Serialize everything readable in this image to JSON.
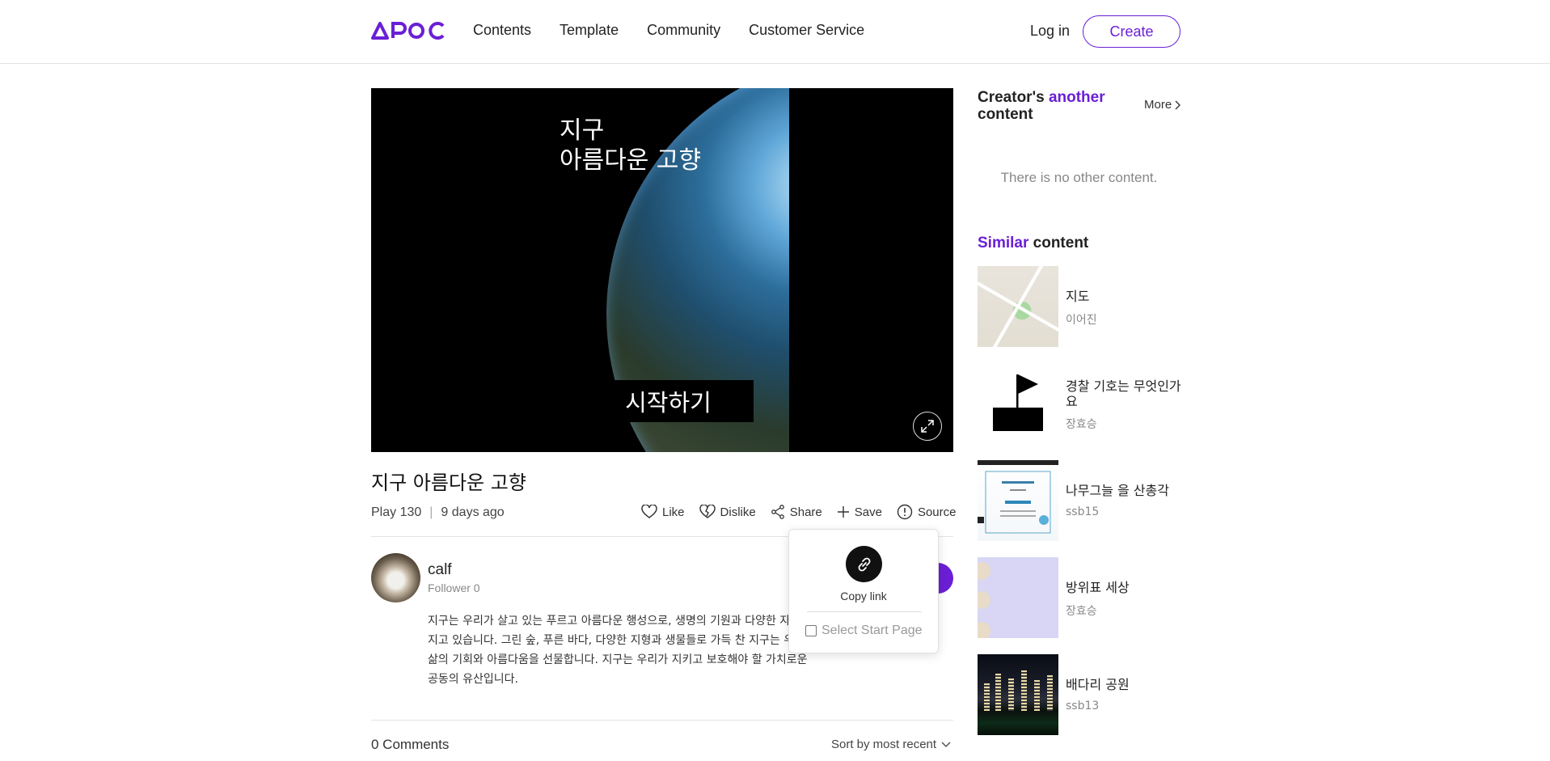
{
  "header": {
    "logo_text": "APOC",
    "nav": [
      "Contents",
      "Template",
      "Community",
      "Customer Service"
    ],
    "login_label": "Log in",
    "create_label": "Create",
    "brand_color": "#6a1fd6"
  },
  "player": {
    "slide_title_line1": "지구",
    "slide_title_line2": "아름다운 고향",
    "start_button": "시작하기",
    "fullscreen_icon": "expand-icon"
  },
  "content": {
    "title": "지구 아름다운 고향",
    "play": "Play 130",
    "separator": "|",
    "posted": "9 days ago",
    "actions": {
      "like": "Like",
      "dislike": "Dislike",
      "share": "Share",
      "save": "Save",
      "source": "Source"
    }
  },
  "creator": {
    "name": "calf",
    "followers": "Follower 0",
    "description": "지구는 우리가 살고 있는 푸르고 아름다운 행성으로, 생명의 기원과 다양한 자원을 지고 있습니다. 그린 숲, 푸른 바다, 다양한 지형과 생물들로 가득 찬 지구는 우리 삶의 기회와 아름다움을 선물합니다. 지구는 우리가 지키고 보호해야 할 가치로운 공동의 유산입니다."
  },
  "share_popover": {
    "copy_link": "Copy link",
    "select_start_page": "Select Start Page",
    "select_start_checked": false
  },
  "comments": {
    "count": "0 Comments",
    "sort": "Sort by most recent"
  },
  "sidebar": {
    "creator_heading_pre": "Creator's ",
    "creator_heading_accent": "another",
    "creator_heading_post": "content",
    "more_label": "More",
    "no_content": "There is no other content.",
    "similar_accent": "Similar",
    "similar_rest": " content",
    "similar_items": [
      {
        "title": "지도",
        "author": "이어진"
      },
      {
        "title": "경찰 기호는 무엇인가요",
        "author": "장효승"
      },
      {
        "title": "나무그늘 을 산총각",
        "author": "ssb15"
      },
      {
        "title": "방위표 세상",
        "author": "장효승"
      },
      {
        "title": "배다리 공원",
        "author": "ssb13"
      }
    ]
  }
}
